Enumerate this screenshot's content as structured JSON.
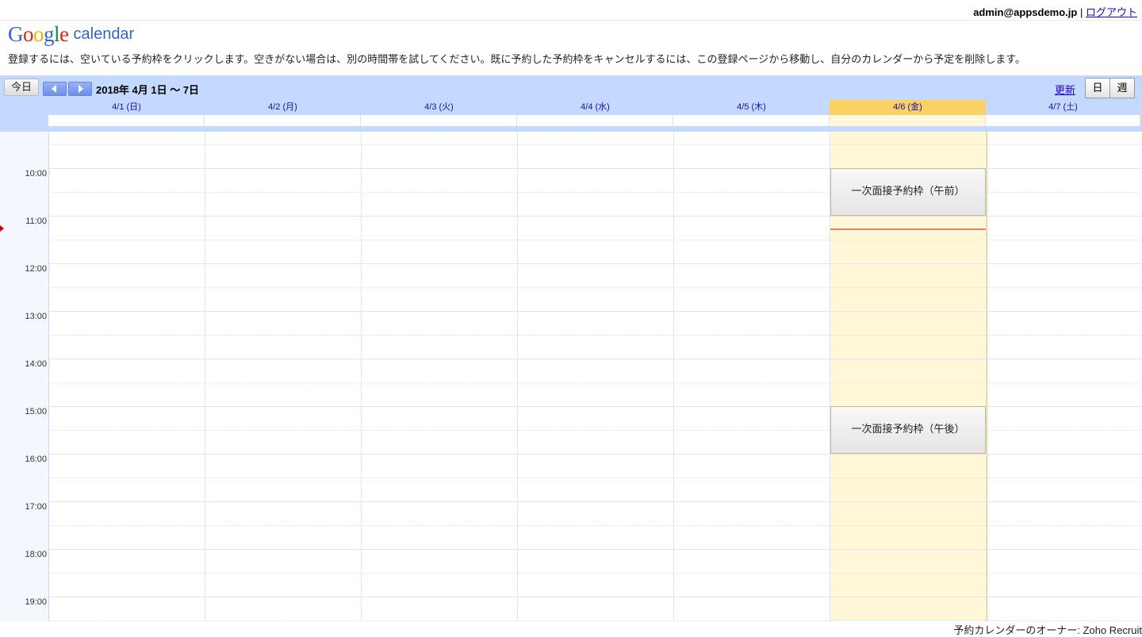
{
  "header": {
    "user_email": "admin@appsdemo.jp",
    "separator": "|",
    "logout_label": "ログアウト"
  },
  "logo": {
    "google": "Google",
    "product": "calendar"
  },
  "instructions": "登録するには、空いている予約枠をクリックします。空きがない場合は、別の時間帯を試してください。既に予約した予約枠をキャンセルするには、この登録ページから移動し、自分のカレンダーから予定を削除します。",
  "toolbar": {
    "today_label": "今日",
    "date_range": "2018年 4月 1日 ～ 7日",
    "refresh_label": "更新",
    "view_day_label": "日",
    "view_week_label": "週"
  },
  "days": [
    {
      "label": "4/1 (日)"
    },
    {
      "label": "4/2 (月)"
    },
    {
      "label": "4/3 (火)"
    },
    {
      "label": "4/4 (水)"
    },
    {
      "label": "4/5 (木)"
    },
    {
      "label": "4/6 (金)"
    },
    {
      "label": "4/7 (土)"
    }
  ],
  "times": [
    "10:00",
    "11:00",
    "12:00",
    "13:00",
    "14:00",
    "15:00",
    "16:00",
    "17:00",
    "18:00",
    "19:00"
  ],
  "slots": [
    {
      "title": "一次面接予約枠（午前）",
      "day": "4/6 (金)",
      "time": "10:00"
    },
    {
      "title": "一次面接予約枠（午後）",
      "day": "4/6 (金)",
      "time": "15:00"
    }
  ],
  "footer": "予約カレンダーのオーナー: Zoho Recruit",
  "colors": {
    "accent": "#c3d9ff",
    "today": "#fff7d7",
    "today_header": "#fad163",
    "now_line": "#f08060",
    "link": "#2200cc"
  }
}
